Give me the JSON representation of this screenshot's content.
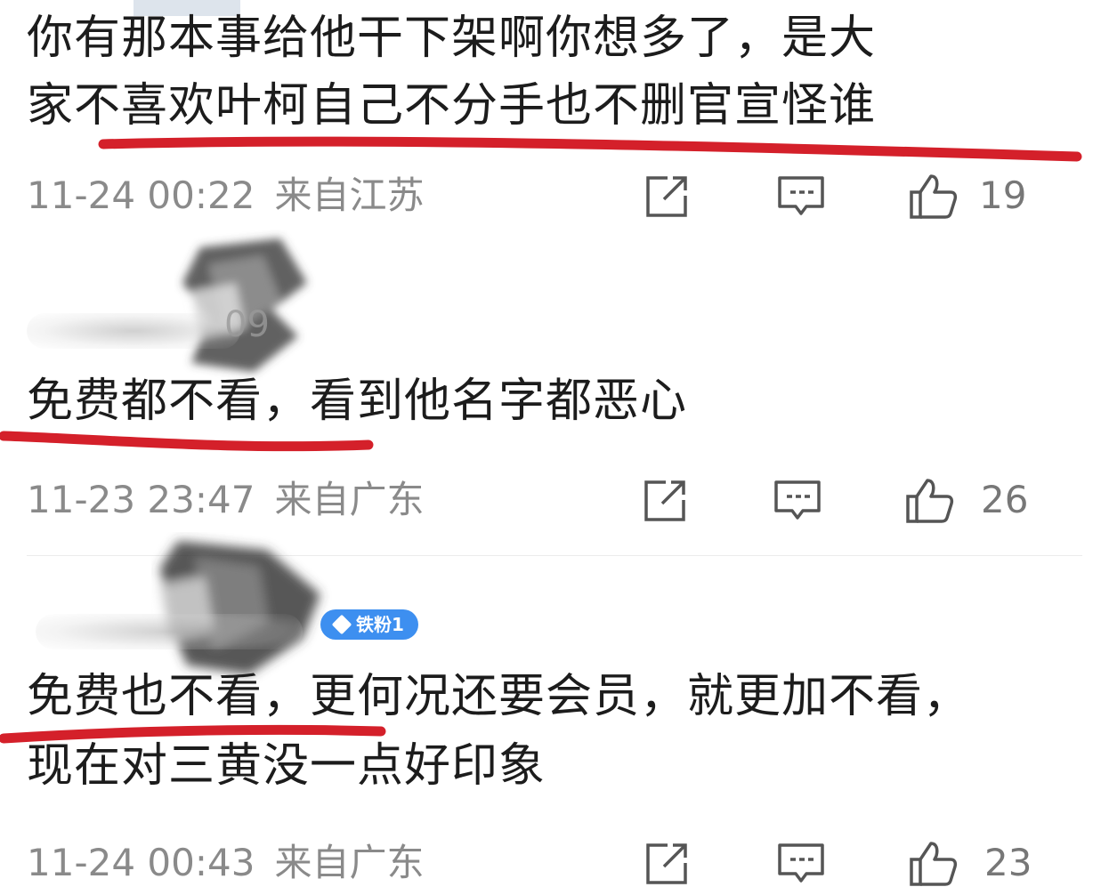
{
  "comments": [
    {
      "text_lines": [
        "你有那本事给他干下架啊你想多了，是大",
        "家不喜欢叶柯自己不分手也不删官宣怪谁"
      ],
      "time": "11-24 00:22",
      "location": "来自江苏",
      "likes": "19"
    },
    {
      "user_name": "09",
      "text_lines": [
        "免费都不看，看到他名字都恶心"
      ],
      "time": "11-23 23:47",
      "location": "来自广东",
      "likes": "26"
    },
    {
      "badge": "铁粉1",
      "text_lines": [
        "免费也不看，更何况还要会员，就更加不看，",
        "现在对三黄没一点好印象"
      ],
      "time": "11-24 00:43",
      "location": "来自广东",
      "likes": "23"
    }
  ],
  "icons": {
    "share": "share-icon",
    "comment": "comment-icon",
    "like": "thumbs-up-icon"
  },
  "colors": {
    "underline": "#d4202a",
    "meta_text": "#8a8a8a",
    "badge": "#3d8ff0"
  }
}
